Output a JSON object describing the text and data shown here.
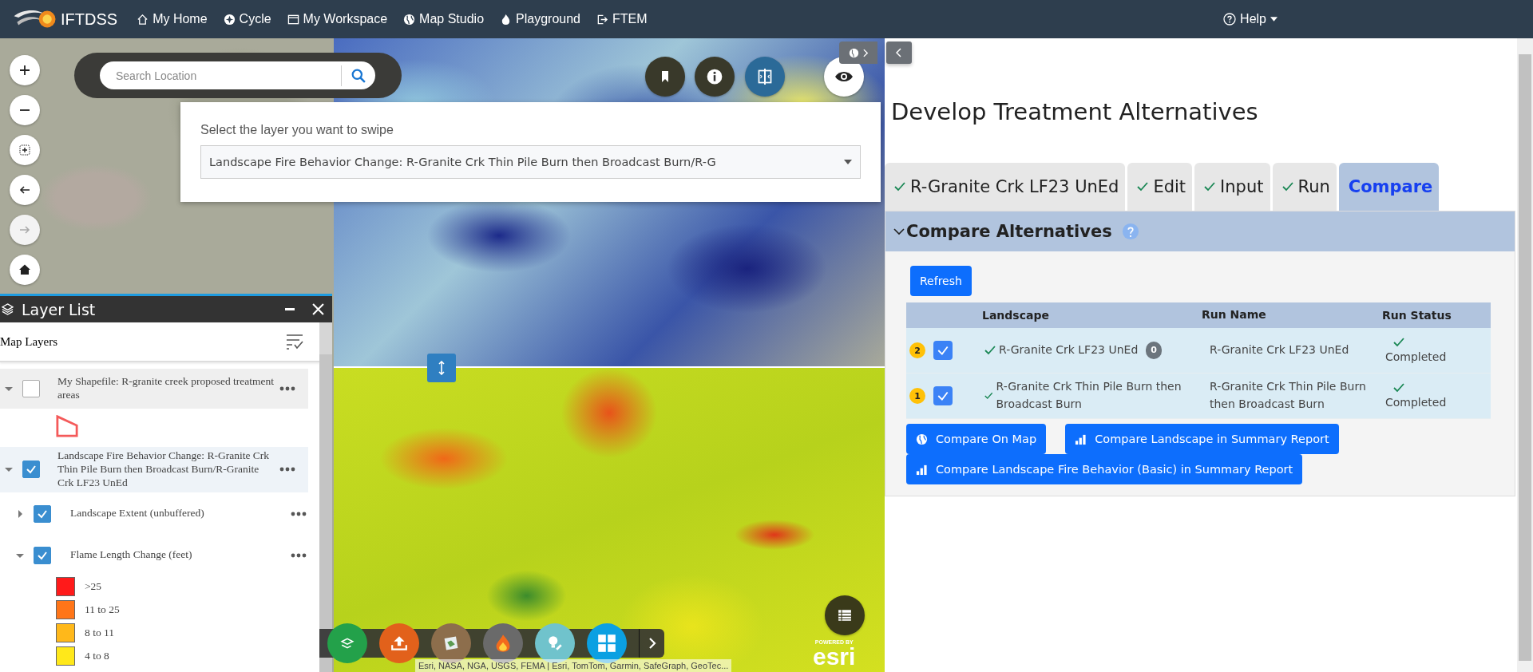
{
  "nav": {
    "brand": "IFTDSS",
    "items": [
      {
        "label": "My Home"
      },
      {
        "label": "Cycle"
      },
      {
        "label": "My Workspace"
      },
      {
        "label": "Map Studio"
      },
      {
        "label": "Playground"
      },
      {
        "label": "FTEM"
      }
    ],
    "help": "Help"
  },
  "map": {
    "search": {
      "placeholder": "Search Location"
    },
    "swipe": {
      "prompt": "Select the layer you want to swipe",
      "value": "Landscape Fire Behavior Change: R-Granite Crk Thin Pile Burn then Broadcast Burn/R-G"
    },
    "attribution": "Esri, NASA, NGA, USGS, FEMA | Esri, TomTom, Garmin, SafeGraph, GeoTec...",
    "esri": {
      "powered": "POWERED BY",
      "brand": "esri"
    }
  },
  "layer_list": {
    "title": "Layer List",
    "subtitle": "Map Layers",
    "layers": [
      {
        "kind": "vector",
        "label": "My Shapefile: R-granite creek proposed treatment areas",
        "checked": false,
        "expanded": true
      },
      {
        "kind": "group",
        "label": "Landscape Fire Behavior Change: R-Granite Crk Thin Pile Burn then Broadcast Burn/R-Granite Crk LF23 UnEd",
        "checked": true,
        "expanded": true,
        "children": [
          {
            "kind": "vector",
            "label": "Landscape Extent (unbuffered)",
            "checked": true,
            "expanded": false
          },
          {
            "kind": "raster",
            "label": "Flame Length Change (feet)",
            "checked": true,
            "expanded": true,
            "legend": [
              {
                "label": ">25",
                "color": "#ff1a1a"
              },
              {
                "label": "11 to 25",
                "color": "#ff7518"
              },
              {
                "label": "8 to 11",
                "color": "#ffb81a"
              },
              {
                "label": "4 to 8",
                "color": "#ffe81a"
              }
            ]
          }
        ]
      }
    ]
  },
  "panel": {
    "title": "Develop Treatment Alternatives",
    "tabs": [
      {
        "label": "R-Granite Crk LF23 UnEd",
        "done": true,
        "selected": false
      },
      {
        "label": "Edit",
        "done": true,
        "selected": false
      },
      {
        "label": "Input",
        "done": true,
        "selected": false
      },
      {
        "label": "Run",
        "done": true,
        "selected": false
      },
      {
        "label": "Compare",
        "done": false,
        "selected": true
      }
    ],
    "section": {
      "title": "Compare Alternatives",
      "expanded": true
    },
    "refresh": "Refresh",
    "table": {
      "columns": [
        "Landscape",
        "Run Name",
        "Run Status"
      ],
      "rows": [
        {
          "order": "2",
          "checked": true,
          "landscape": "R-Granite Crk LF23 UnEd",
          "badge": "0",
          "run_name": "R-Granite Crk LF23 UnEd",
          "status": "Completed"
        },
        {
          "order": "1",
          "checked": true,
          "landscape": "R-Granite Crk Thin Pile Burn then Broadcast Burn",
          "run_name": "R-Granite Crk Thin Pile Burn then Broadcast Burn",
          "status": "Completed"
        }
      ]
    },
    "actions": [
      {
        "kind": "map",
        "label": "Compare On Map"
      },
      {
        "kind": "report",
        "label": "Compare Landscape in Summary Report"
      },
      {
        "kind": "report",
        "label": "Compare Landscape Fire Behavior (Basic) in Summary Report"
      }
    ]
  }
}
